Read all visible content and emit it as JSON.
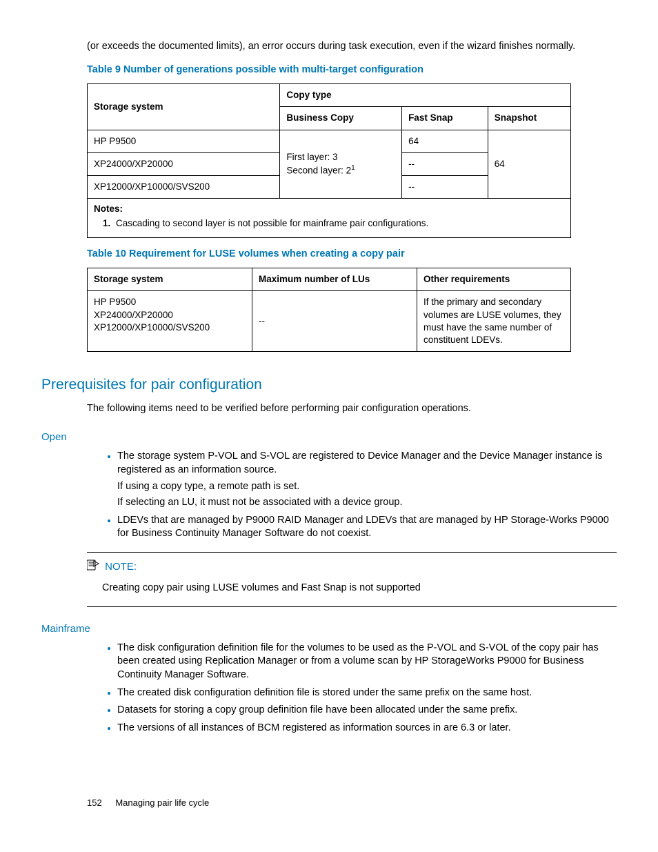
{
  "intro": "(or exceeds the documented limits), an error occurs during task execution, even if the wizard finishes normally.",
  "table9": {
    "caption": "Table 9 Number of generations possible with multi-target configuration",
    "headers": {
      "storage": "Storage system",
      "copytype": "Copy type",
      "bc": "Business Copy",
      "fs": "Fast Snap",
      "sn": "Snapshot"
    },
    "bc_prefix": "First layer: 3",
    "bc_prefix2": "Second layer: 2",
    "sn_val": "64",
    "rows": {
      "r1": {
        "sys": "HP P9500",
        "fs": "64"
      },
      "r2": {
        "sys": "XP24000/XP20000",
        "fs": "--"
      },
      "r3": {
        "sys": "XP12000/XP10000/SVS200",
        "fs": "--"
      }
    },
    "notes_head": "Notes:",
    "notes_1": "Cascading to second layer is not possible for mainframe pair configurations."
  },
  "table10": {
    "caption": "Table 10 Requirement for LUSE volumes when creating a copy pair",
    "headers": {
      "storage": "Storage system",
      "max": "Maximum number of LUs",
      "other": "Other requirements"
    },
    "row": {
      "sys1": "HP P9500",
      "sys2": "XP24000/XP20000",
      "sys3": "XP12000/XP10000/SVS200",
      "max": "--",
      "other": "If the primary and secondary volumes are LUSE volumes, they must have the same number of constituent LDEVs."
    }
  },
  "prereq": {
    "heading": "Prerequisites for pair configuration",
    "intro": "The following items need to be verified before performing pair configuration operations."
  },
  "open": {
    "heading": "Open",
    "b1a": "The storage system P-VOL and S-VOL are registered to Device Manager and the Device Manager instance is registered as an information source.",
    "b1b": "If using a copy type, a remote path is set.",
    "b1c": "If selecting an LU, it must not be associated with a device group.",
    "b2": "LDEVs that are managed by P9000 RAID Manager and LDEVs that are managed by HP Storage-Works P9000 for Business Continuity Manager Software do not coexist."
  },
  "note": {
    "head": "NOTE:",
    "body": "Creating copy pair using LUSE volumes and Fast Snap is not supported"
  },
  "mainframe": {
    "heading": "Mainframe",
    "b1": "The disk configuration definition file for the volumes to be used as the P-VOL and S-VOL of the copy pair has been created using Replication Manager or from a volume scan by HP StorageWorks P9000 for Business Continuity Manager Software.",
    "b2": "The created disk configuration definition file is stored under the same prefix on the same host.",
    "b3": "Datasets for storing a copy group definition file have been allocated under the same prefix.",
    "b4": "The versions of all instances of BCM registered as information sources in are 6.3 or later."
  },
  "footer": {
    "page": "152",
    "title": "Managing pair life cycle"
  }
}
